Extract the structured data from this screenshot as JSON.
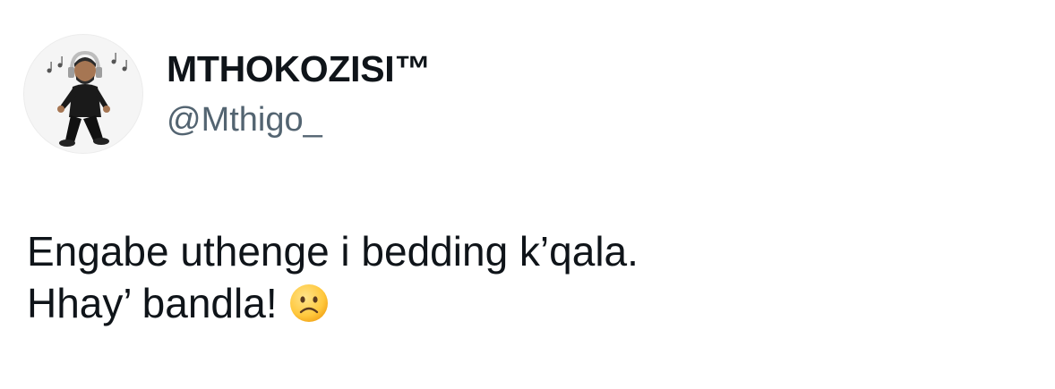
{
  "user": {
    "display_name": "MTHOKOZISI™",
    "handle": "@Mthigo_"
  },
  "tweet": {
    "line1": "Engabe uthenge i bedding k’qala.",
    "line2": "Hhay’ bandla!",
    "emoji": "frowning-face-icon"
  },
  "colors": {
    "text": "#0f1419",
    "secondary_text": "#536471",
    "background": "#ffffff",
    "emoji_yellow": "#ffc83d"
  }
}
